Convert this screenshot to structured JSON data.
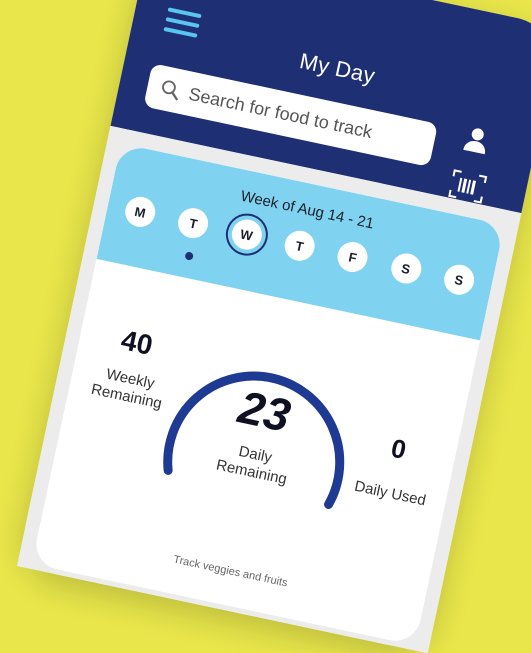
{
  "header": {
    "title": "My Day",
    "search_placeholder": "Search for food to track"
  },
  "week": {
    "label": "Week of Aug 14 - 21",
    "days": [
      "M",
      "T",
      "W",
      "T",
      "F",
      "S",
      "S"
    ],
    "selected_day": "W"
  },
  "stats": {
    "weekly_remaining": {
      "value": "40",
      "label": "Weekly Remaining"
    },
    "daily_remaining": {
      "value": "23",
      "label": "Daily Remaining"
    },
    "daily_used": {
      "value": "0",
      "label": "Daily Used"
    }
  },
  "footer": {
    "hint": "Track veggies and fruits"
  },
  "colors": {
    "background": "#e8e64a",
    "header": "#1f2f74",
    "accent": "#59c6f2",
    "week_strip": "#7fd3f0",
    "gauge": "#1f3a93"
  }
}
